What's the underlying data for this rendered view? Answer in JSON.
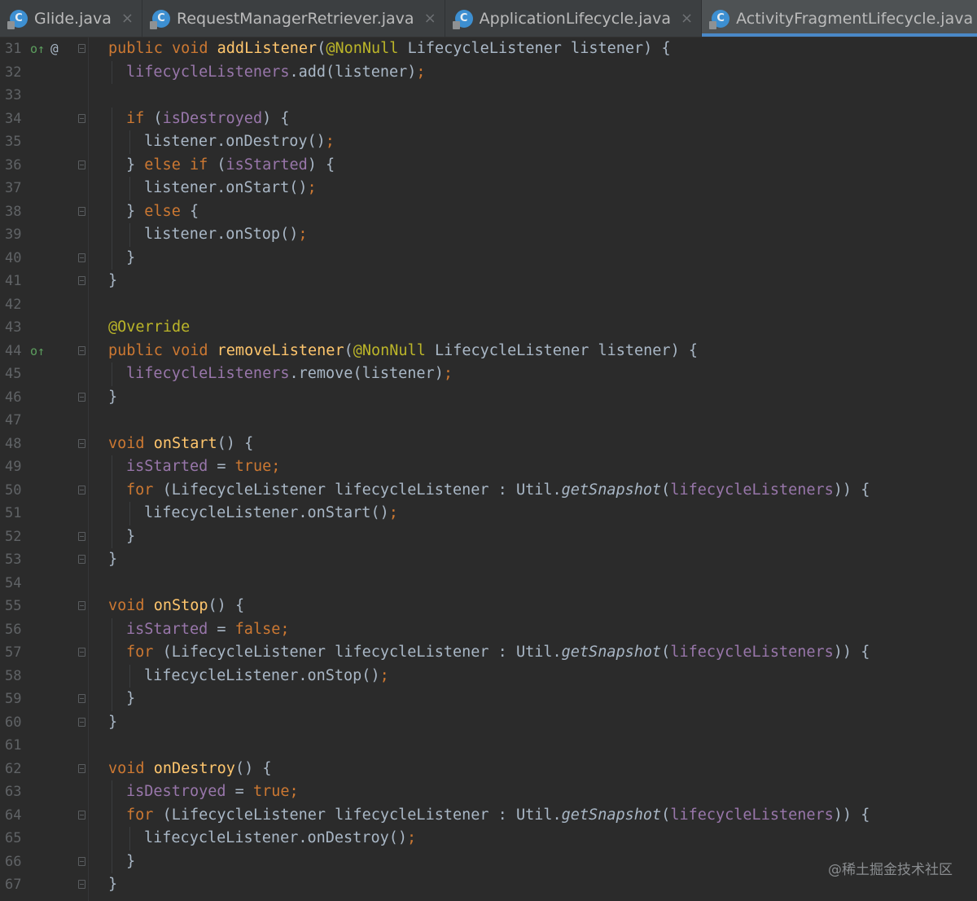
{
  "tabs": [
    {
      "label": "Glide.java",
      "icon": "java-class-icon",
      "active": false
    },
    {
      "label": "RequestManagerRetriever.java",
      "icon": "java-class-icon",
      "active": false
    },
    {
      "label": "ApplicationLifecycle.java",
      "icon": "java-class-icon",
      "active": false
    },
    {
      "label": "ActivityFragmentLifecycle.java",
      "icon": "java-class-icon",
      "active": true
    }
  ],
  "tab_icon_letter": "C",
  "close_glyph": "×",
  "gutter_markers": {
    "implements": "o↑",
    "override": "@"
  },
  "watermark": "@稀土掘金技术社区",
  "colors": {
    "background": "#2b2b2b",
    "keyword": "#cc7832",
    "method": "#ffc66d",
    "annotation": "#bbb529",
    "field": "#9876aa",
    "text": "#a9b7c6",
    "active_tab_underline": "#4a88c7"
  },
  "lines": [
    {
      "num": "31",
      "marker": "implements",
      "at": true,
      "fold": true,
      "indent": 0,
      "tokens": [
        [
          "kw",
          "public void "
        ],
        [
          "fn",
          "addListener"
        ],
        [
          "tx",
          "("
        ],
        [
          "an",
          "@NonNull"
        ],
        [
          "tx",
          " LifecycleListener listener) {"
        ]
      ]
    },
    {
      "num": "32",
      "fold": false,
      "indent": 1,
      "tokens": [
        [
          "fd",
          "lifecycleListeners"
        ],
        [
          "tx",
          ".add(listener)"
        ],
        [
          "pn",
          ";"
        ]
      ]
    },
    {
      "num": "33",
      "fold": false,
      "indent": 0,
      "tokens": []
    },
    {
      "num": "34",
      "fold": true,
      "indent": 1,
      "tokens": [
        [
          "kw",
          "if "
        ],
        [
          "tx",
          "("
        ],
        [
          "fd",
          "isDestroyed"
        ],
        [
          "tx",
          ") {"
        ]
      ]
    },
    {
      "num": "35",
      "fold": false,
      "indent": 2,
      "tokens": [
        [
          "tx",
          "listener.onDestroy()"
        ],
        [
          "pn",
          ";"
        ]
      ]
    },
    {
      "num": "36",
      "fold": true,
      "indent": 1,
      "tokens": [
        [
          "tx",
          "} "
        ],
        [
          "kw",
          "else if "
        ],
        [
          "tx",
          "("
        ],
        [
          "fd",
          "isStarted"
        ],
        [
          "tx",
          ") {"
        ]
      ]
    },
    {
      "num": "37",
      "fold": false,
      "indent": 2,
      "tokens": [
        [
          "tx",
          "listener.onStart()"
        ],
        [
          "pn",
          ";"
        ]
      ]
    },
    {
      "num": "38",
      "fold": true,
      "indent": 1,
      "tokens": [
        [
          "tx",
          "} "
        ],
        [
          "kw",
          "else "
        ],
        [
          "tx",
          "{"
        ]
      ]
    },
    {
      "num": "39",
      "fold": false,
      "indent": 2,
      "tokens": [
        [
          "tx",
          "listener.onStop()"
        ],
        [
          "pn",
          ";"
        ]
      ]
    },
    {
      "num": "40",
      "fold": true,
      "indent": 1,
      "tokens": [
        [
          "tx",
          "}"
        ]
      ]
    },
    {
      "num": "41",
      "fold": true,
      "indent": 0,
      "tokens": [
        [
          "tx",
          "}"
        ]
      ]
    },
    {
      "num": "42",
      "fold": false,
      "indent": 0,
      "tokens": []
    },
    {
      "num": "43",
      "fold": false,
      "indent": 0,
      "tokens": [
        [
          "an",
          "@Override"
        ]
      ]
    },
    {
      "num": "44",
      "marker": "implements",
      "fold": true,
      "indent": 0,
      "tokens": [
        [
          "kw",
          "public void "
        ],
        [
          "fn",
          "removeListener"
        ],
        [
          "tx",
          "("
        ],
        [
          "an",
          "@NonNull"
        ],
        [
          "tx",
          " LifecycleListener listener) {"
        ]
      ]
    },
    {
      "num": "45",
      "fold": false,
      "indent": 1,
      "tokens": [
        [
          "fd",
          "lifecycleListeners"
        ],
        [
          "tx",
          ".remove(listener)"
        ],
        [
          "pn",
          ";"
        ]
      ]
    },
    {
      "num": "46",
      "fold": true,
      "indent": 0,
      "tokens": [
        [
          "tx",
          "}"
        ]
      ]
    },
    {
      "num": "47",
      "fold": false,
      "indent": 0,
      "tokens": []
    },
    {
      "num": "48",
      "fold": true,
      "indent": 0,
      "tokens": [
        [
          "kw",
          "void "
        ],
        [
          "fn",
          "onStart"
        ],
        [
          "tx",
          "() {"
        ]
      ]
    },
    {
      "num": "49",
      "fold": false,
      "indent": 1,
      "tokens": [
        [
          "fd",
          "isStarted"
        ],
        [
          "tx",
          " = "
        ],
        [
          "kw",
          "true;"
        ]
      ]
    },
    {
      "num": "50",
      "fold": true,
      "indent": 1,
      "tokens": [
        [
          "kw",
          "for "
        ],
        [
          "tx",
          "(LifecycleListener lifecycleListener : Util."
        ],
        [
          "it",
          "getSnapshot"
        ],
        [
          "tx",
          "("
        ],
        [
          "fd",
          "lifecycleListeners"
        ],
        [
          "tx",
          ")) {"
        ]
      ]
    },
    {
      "num": "51",
      "fold": false,
      "indent": 2,
      "tokens": [
        [
          "tx",
          "lifecycleListener.onStart()"
        ],
        [
          "pn",
          ";"
        ]
      ]
    },
    {
      "num": "52",
      "fold": true,
      "indent": 1,
      "tokens": [
        [
          "tx",
          "}"
        ]
      ]
    },
    {
      "num": "53",
      "fold": true,
      "indent": 0,
      "tokens": [
        [
          "tx",
          "}"
        ]
      ]
    },
    {
      "num": "54",
      "fold": false,
      "indent": 0,
      "tokens": []
    },
    {
      "num": "55",
      "fold": true,
      "indent": 0,
      "tokens": [
        [
          "kw",
          "void "
        ],
        [
          "fn",
          "onStop"
        ],
        [
          "tx",
          "() {"
        ]
      ]
    },
    {
      "num": "56",
      "fold": false,
      "indent": 1,
      "tokens": [
        [
          "fd",
          "isStarted"
        ],
        [
          "tx",
          " = "
        ],
        [
          "kw",
          "false;"
        ]
      ]
    },
    {
      "num": "57",
      "fold": true,
      "indent": 1,
      "tokens": [
        [
          "kw",
          "for "
        ],
        [
          "tx",
          "(LifecycleListener lifecycleListener : Util."
        ],
        [
          "it",
          "getSnapshot"
        ],
        [
          "tx",
          "("
        ],
        [
          "fd",
          "lifecycleListeners"
        ],
        [
          "tx",
          ")) {"
        ]
      ]
    },
    {
      "num": "58",
      "fold": false,
      "indent": 2,
      "tokens": [
        [
          "tx",
          "lifecycleListener.onStop()"
        ],
        [
          "pn",
          ";"
        ]
      ]
    },
    {
      "num": "59",
      "fold": true,
      "indent": 1,
      "tokens": [
        [
          "tx",
          "}"
        ]
      ]
    },
    {
      "num": "60",
      "fold": true,
      "indent": 0,
      "tokens": [
        [
          "tx",
          "}"
        ]
      ]
    },
    {
      "num": "61",
      "fold": false,
      "indent": 0,
      "tokens": []
    },
    {
      "num": "62",
      "fold": true,
      "indent": 0,
      "tokens": [
        [
          "kw",
          "void "
        ],
        [
          "fn",
          "onDestroy"
        ],
        [
          "tx",
          "() {"
        ]
      ]
    },
    {
      "num": "63",
      "fold": false,
      "indent": 1,
      "tokens": [
        [
          "fd",
          "isDestroyed"
        ],
        [
          "tx",
          " = "
        ],
        [
          "kw",
          "true;"
        ]
      ]
    },
    {
      "num": "64",
      "fold": true,
      "indent": 1,
      "tokens": [
        [
          "kw",
          "for "
        ],
        [
          "tx",
          "(LifecycleListener lifecycleListener : Util."
        ],
        [
          "it",
          "getSnapshot"
        ],
        [
          "tx",
          "("
        ],
        [
          "fd",
          "lifecycleListeners"
        ],
        [
          "tx",
          ")) {"
        ]
      ]
    },
    {
      "num": "65",
      "fold": false,
      "indent": 2,
      "tokens": [
        [
          "tx",
          "lifecycleListener.onDestroy()"
        ],
        [
          "pn",
          ";"
        ]
      ]
    },
    {
      "num": "66",
      "fold": true,
      "indent": 1,
      "tokens": [
        [
          "tx",
          "}"
        ]
      ]
    },
    {
      "num": "67",
      "fold": true,
      "indent": 0,
      "tokens": [
        [
          "tx",
          "}"
        ]
      ]
    }
  ]
}
